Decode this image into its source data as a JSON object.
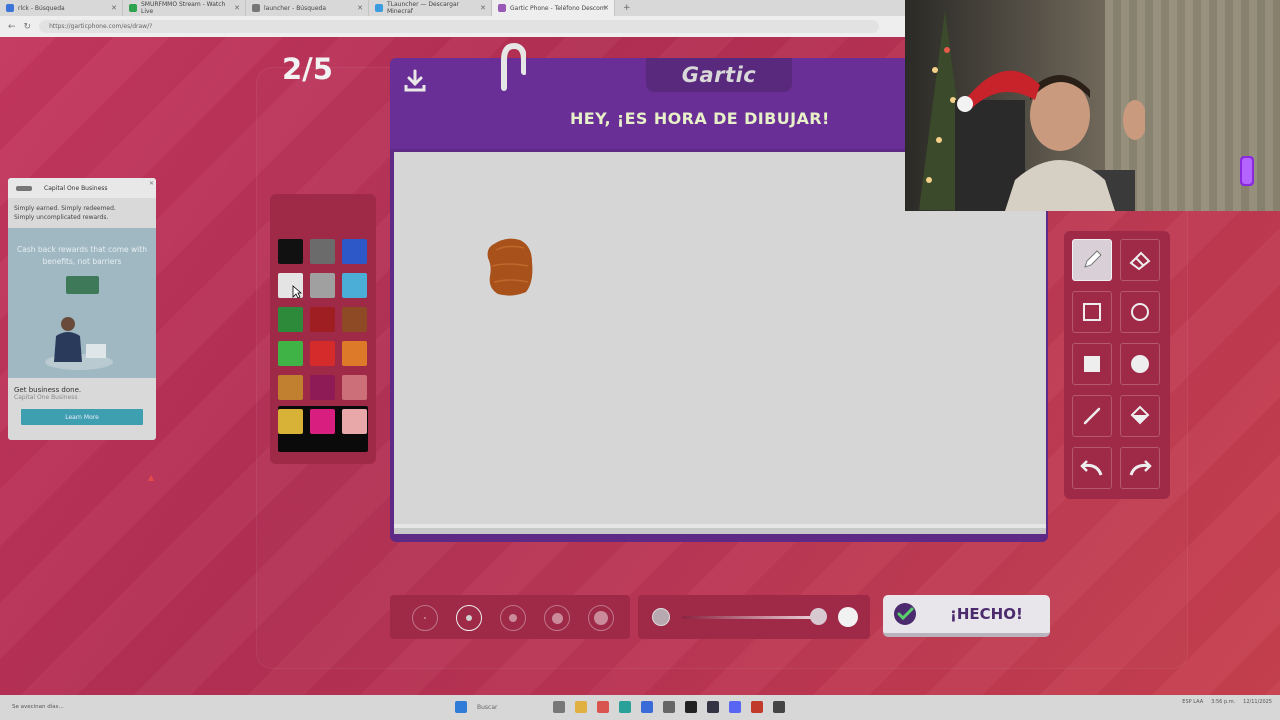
{
  "browser": {
    "tabs": [
      {
        "label": "rlck - Búsqueda",
        "color": "#3b74d8",
        "active": false
      },
      {
        "label": "SMURFMMO Stream - Watch Live",
        "color": "#2ea44f",
        "active": false
      },
      {
        "label": "launcher - Búsqueda",
        "color": "#555555",
        "active": false
      },
      {
        "label": "TLauncher — Descargar Minecraf",
        "color": "#3d9be0",
        "active": false
      },
      {
        "label": "Gartic Phone - Teléfono Descom",
        "color": "#9b59b6",
        "active": true
      }
    ],
    "new_tab": "+",
    "url": "https://garticphone.com/es/draw/?"
  },
  "game": {
    "round": "2/5",
    "brand": "Gartic",
    "headline": "HEY, ¡ES HORA DE DIBUJAR!",
    "done_label": "¡HECHO!",
    "palette": {
      "colors": [
        "#111111",
        "#6b6b6b",
        "#2c58c8",
        "#e4e4e4",
        "#a0a0a0",
        "#4aaed6",
        "#2d8a3a",
        "#9e1e22",
        "#8d4a24",
        "#3fb346",
        "#d62b2b",
        "#dd7a2a",
        "#c08030",
        "#8e1a56",
        "#cc6f78",
        "#d8b236",
        "#d81e7e",
        "#e8a8aa"
      ],
      "current": "#0a0a0a"
    },
    "stroke_color": "#a8511b",
    "tools": [
      "pencil-icon",
      "eraser-icon",
      "rectangle-outline-icon",
      "circle-outline-icon",
      "rectangle-filled-icon",
      "circle-filled-icon",
      "line-icon",
      "fill-bucket-icon",
      "undo-icon",
      "redo-icon"
    ],
    "selected_tool": "pencil-icon",
    "brush_sizes": [
      "size-1",
      "size-2",
      "size-3",
      "size-4",
      "size-5"
    ],
    "selected_size": 2
  },
  "ad": {
    "brand": "Capital One Business",
    "tagline_1": "Simply earned. Simply redeemed.",
    "tagline_2": "Simply uncomplicated rewards.",
    "hero_text": "Cash back rewards that come with benefits, not barriers",
    "cta_title": "Get business done.",
    "cta_sub": "Capital One Business",
    "button": "Learn More"
  },
  "taskbar": {
    "weather": "Se avecinan días...",
    "search": "Buscar",
    "lang": "ESP LAA",
    "time": "3:56 p.m.",
    "date": "12/11/2025"
  }
}
